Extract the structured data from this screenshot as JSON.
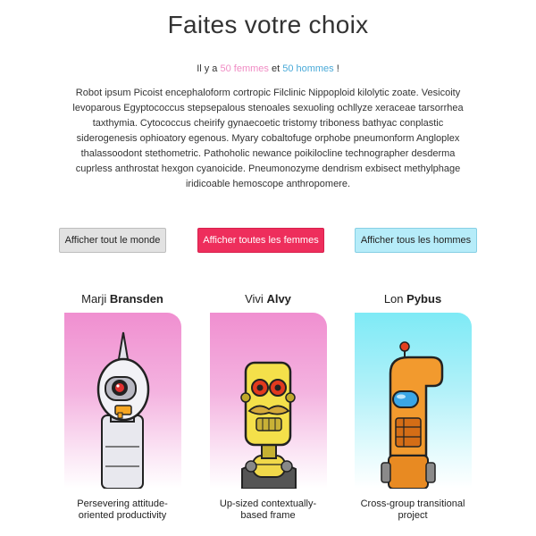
{
  "page": {
    "title": "Faites votre choix",
    "count": {
      "prefix": "Il y a ",
      "women": "50 femmes",
      "middle": " et ",
      "men": "50 hommes",
      "suffix": " !"
    },
    "description": "Robot ipsum Picoist encephaloform cortropic Filclinic Nippoploid kilolytic zoate. Vesicoity levoparous Egyptococcus stepsepalous stenoales sexuoling ochllyze xeraceae tarsorrhea taxthymia. Cytococcus cheirify gynaecoetic tristomy triboness bathyac conplastic siderogenesis ophioatory egenous. Myary cobaltofuge orphobe pneumonform Angloplex thalassoodont stethometric. Pathoholic newance poikilocline technographer desderma cuprless anthrostat hexgon cyanoicide. Pneumonozyme dendrism exbisect methylphage iridicoable hemoscope anthropomere."
  },
  "filters": {
    "all_label": "Afficher tout le monde",
    "women_label": "Afficher toutes les femmes",
    "men_label": "Afficher tous les hommes"
  },
  "colors": {
    "women_accent": "#f08cc4",
    "men_accent": "#4aaad8",
    "women_button": "#ee2e5c",
    "men_button": "#b6ecf9"
  },
  "cards": [
    {
      "first": "Marji",
      "last": "Bransden",
      "caption_line1": "Persevering attitude-",
      "caption_line2": "oriented productivity",
      "image": "white-robot-icon",
      "theme": "pink"
    },
    {
      "first": "Vivi",
      "last": "Alvy",
      "caption_line1": "Up-sized contextually-",
      "caption_line2": "based frame",
      "image": "yellow-robot-icon",
      "theme": "pink"
    },
    {
      "first": "Lon",
      "last": "Pybus",
      "caption_line1": "Cross-group transitional",
      "caption_line2": "project",
      "image": "orange-robot-icon",
      "theme": "blue"
    }
  ]
}
